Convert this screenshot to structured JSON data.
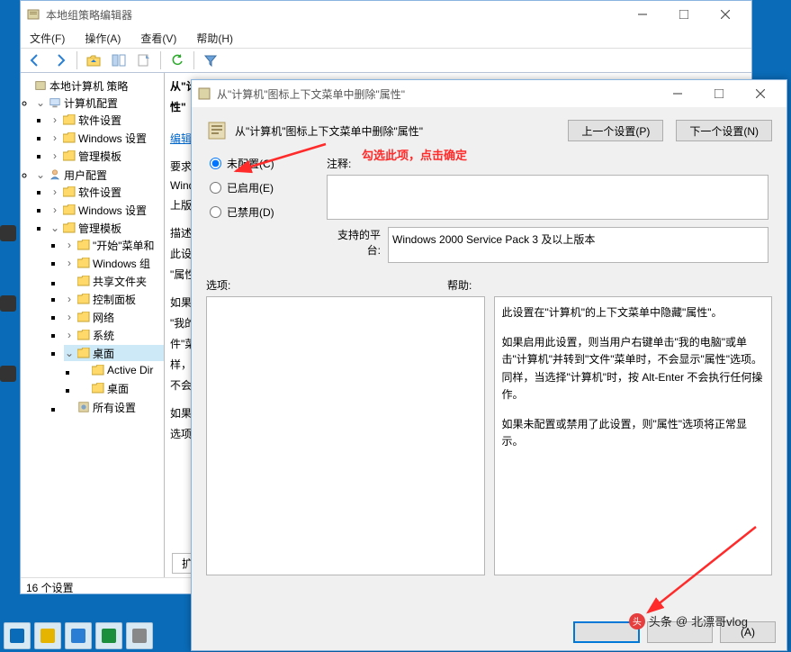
{
  "mainWindow": {
    "title": "本地组策略编辑器",
    "menu": {
      "file": "文件(F)",
      "action": "操作(A)",
      "view": "查看(V)",
      "help": "帮助(H)"
    },
    "statusbar": "16 个设置"
  },
  "tree": {
    "root": "本地计算机 策略",
    "computer": "计算机配置",
    "c_software": "软件设置",
    "c_windows": "Windows 设置",
    "c_admin": "管理模板",
    "user": "用户配置",
    "u_software": "软件设置",
    "u_windows": "Windows 设置",
    "u_admin": "管理模板",
    "u_start": "\"开始\"菜单和",
    "u_wincomp": "Windows 组",
    "u_shared": "共享文件夹",
    "u_control": "控制面板",
    "u_network": "网络",
    "u_system": "系统",
    "u_desktop": "桌面",
    "u_ad": "Active Dir",
    "u_desktop2": "桌面",
    "u_all": "所有设置"
  },
  "rightPane": {
    "line1": "从\"计",
    "line2": "性\"",
    "edit": "编辑",
    "req": "要求:",
    "reqText": "Winde",
    "reqText2": "上版本",
    "desc": "描述:",
    "descText1": "此设定",
    "descText2": "\"属性",
    "if1": "如果",
    "if2": "\"我的",
    "if3": "件\"菜",
    "if4": "样，当",
    "if5": "不会执",
    "if6": "如果未",
    "if7": "选项将",
    "footer": "扩展"
  },
  "dialog": {
    "title": "从\"计算机\"图标上下文菜单中删除\"属性\"",
    "settingTitle": "从\"计算机\"图标上下文菜单中删除\"属性\"",
    "prevBtn": "上一个设置(P)",
    "nextBtn": "下一个设置(N)",
    "radio": {
      "notConfigured": "未配置(C)",
      "enabled": "已启用(E)",
      "disabled": "已禁用(D)"
    },
    "commentLabel": "注释:",
    "platformLabel": "支持的平台:",
    "platformText": "Windows 2000 Service Pack 3 及以上版本",
    "optionsLabel": "选项:",
    "helpLabel": "帮助:",
    "helpText1": "此设置在\"计算机\"的上下文菜单中隐藏\"属性\"。",
    "helpText2": "如果启用此设置，则当用户右键单击\"我的电脑\"或单击\"计算机\"并转到\"文件\"菜单时，不会显示\"属性\"选项。同样，当选择\"计算机\"时，按 Alt-Enter 不会执行任何操作。",
    "helpText3": "如果未配置或禁用了此设置，则\"属性\"选项将正常显示。",
    "okBtn": "(A)"
  },
  "annotation": {
    "text": "勾选此项，点击确定"
  },
  "watermark": {
    "prefix": "头条",
    "at": "@",
    "name": "北漂哥vlog"
  }
}
